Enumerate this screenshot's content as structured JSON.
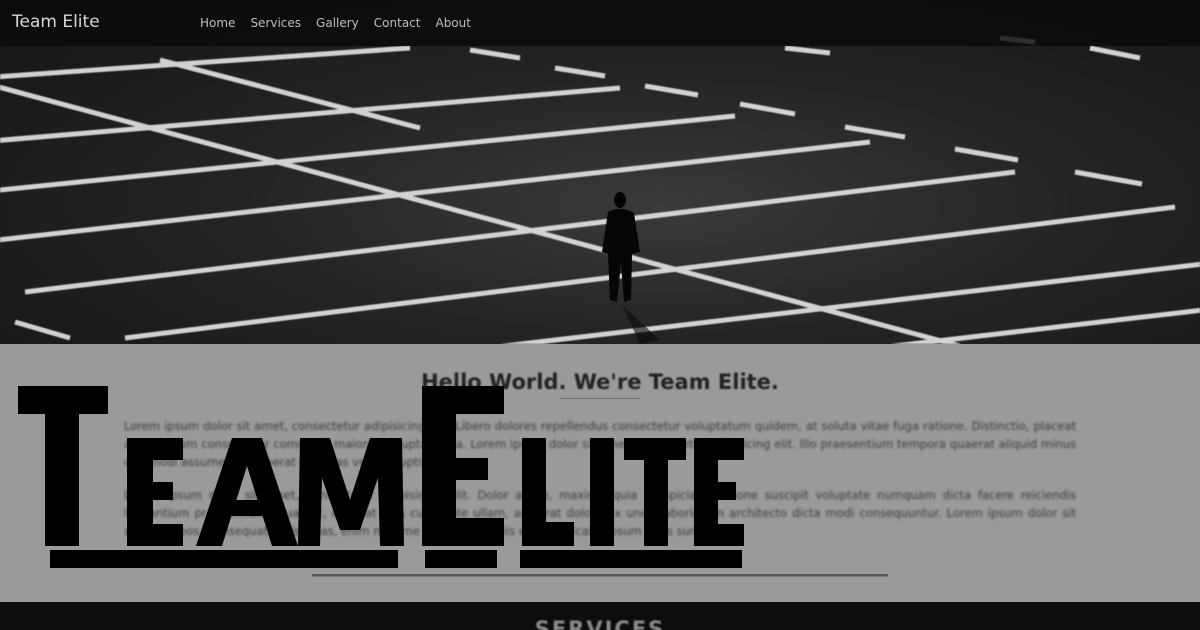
{
  "nav": {
    "brand": "Team Elite",
    "links": [
      "Home",
      "Services",
      "Gallery",
      "Contact",
      "About"
    ]
  },
  "about": {
    "title": "Hello World. We're Team Elite.",
    "paragraph_1": "Lorem ipsum dolor sit amet, consectetur adipisicing elit. Libero dolores repellendus consectetur voluptatum quidem, at soluta vitae fuga ratione. Distinctio, placeat accusantium consectetur commodi, maiores voluptates ea. Lorem ipsum dolor sit amet, consectetur adipisicing elit. Illo praesentium tempora quaerat aliquid minus commodi assumenda quaerat voluptas vel, corrupti.",
    "paragraph_2": "Lorem ipsum dolor sit amet, consectetur adipisicing elit. Dolor atque, maxime quia perspiciatis ratione suscipit voluptate numquam dicta facere reiciendis laudantium praesentium. Quaerat, quaerat eius cupiditate ullam, aut erat dolore ex unde laboriosam architecto dicta modi consequuntur. Lorem ipsum dolor sit amet, ab eos. Consequatur nisi alias, enim maxime magnam officiis eum explicabo ipsum quos sunt."
  },
  "services": {
    "title": "SERVICES"
  },
  "logo": {
    "text": "TeamElite",
    "letters": [
      "T",
      "E",
      "A",
      "M",
      "E",
      "L",
      "I",
      "T",
      "E"
    ]
  },
  "colors": {
    "hero_background": "#242424",
    "about_background": "#9a9a9a",
    "services_background": "#0d0d0d",
    "logo_fill": "#000000",
    "parking_lines": "#e6e6e6"
  }
}
